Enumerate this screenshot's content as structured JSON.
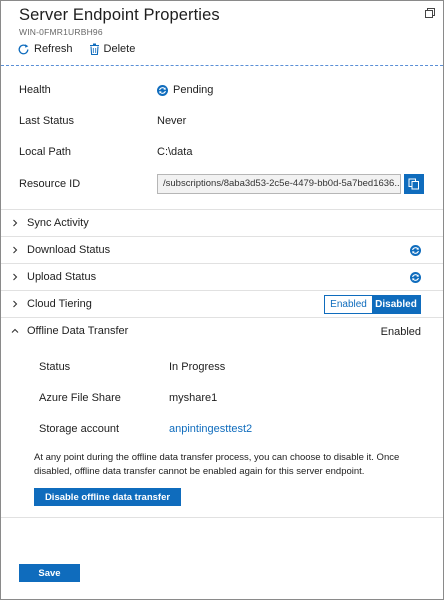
{
  "header": {
    "title": "Server Endpoint Properties",
    "subtitle": "WIN-0FMR1URBH96"
  },
  "toolbar": {
    "refresh_label": "Refresh",
    "delete_label": "Delete"
  },
  "properties": {
    "health": {
      "label": "Health",
      "value": "Pending",
      "icon": "sync-icon"
    },
    "last_status": {
      "label": "Last Status",
      "value": "Never"
    },
    "local_path": {
      "label": "Local Path",
      "value": "C:\\data"
    },
    "resource_id": {
      "label": "Resource ID",
      "value": "/subscriptions/8aba3d53-2c5e-4479-bb0d-5a7bed1636..."
    }
  },
  "sections": {
    "sync_activity": {
      "label": "Sync Activity"
    },
    "download_status": {
      "label": "Download Status",
      "icon": "sync-icon"
    },
    "upload_status": {
      "label": "Upload Status",
      "icon": "sync-icon"
    },
    "cloud_tiering": {
      "label": "Cloud Tiering",
      "options": [
        "Enabled",
        "Disabled"
      ],
      "selected": "Disabled"
    },
    "offline_data_transfer": {
      "label": "Offline Data Transfer",
      "status_text": "Enabled",
      "rows": {
        "status": {
          "label": "Status",
          "value": "In Progress"
        },
        "share": {
          "label": "Azure File Share",
          "value": "myshare1"
        },
        "storage": {
          "label": "Storage account",
          "value": "anpintingesttest2"
        }
      },
      "note": "At any point during the offline data transfer process, you can choose to disable it. Once disabled, offline data transfer cannot be enabled again for this server endpoint.",
      "disable_label": "Disable offline data transfer"
    }
  },
  "footer": {
    "save_label": "Save"
  },
  "colors": {
    "accent": "#0f6cbd",
    "divider": "#e1e1e1"
  }
}
